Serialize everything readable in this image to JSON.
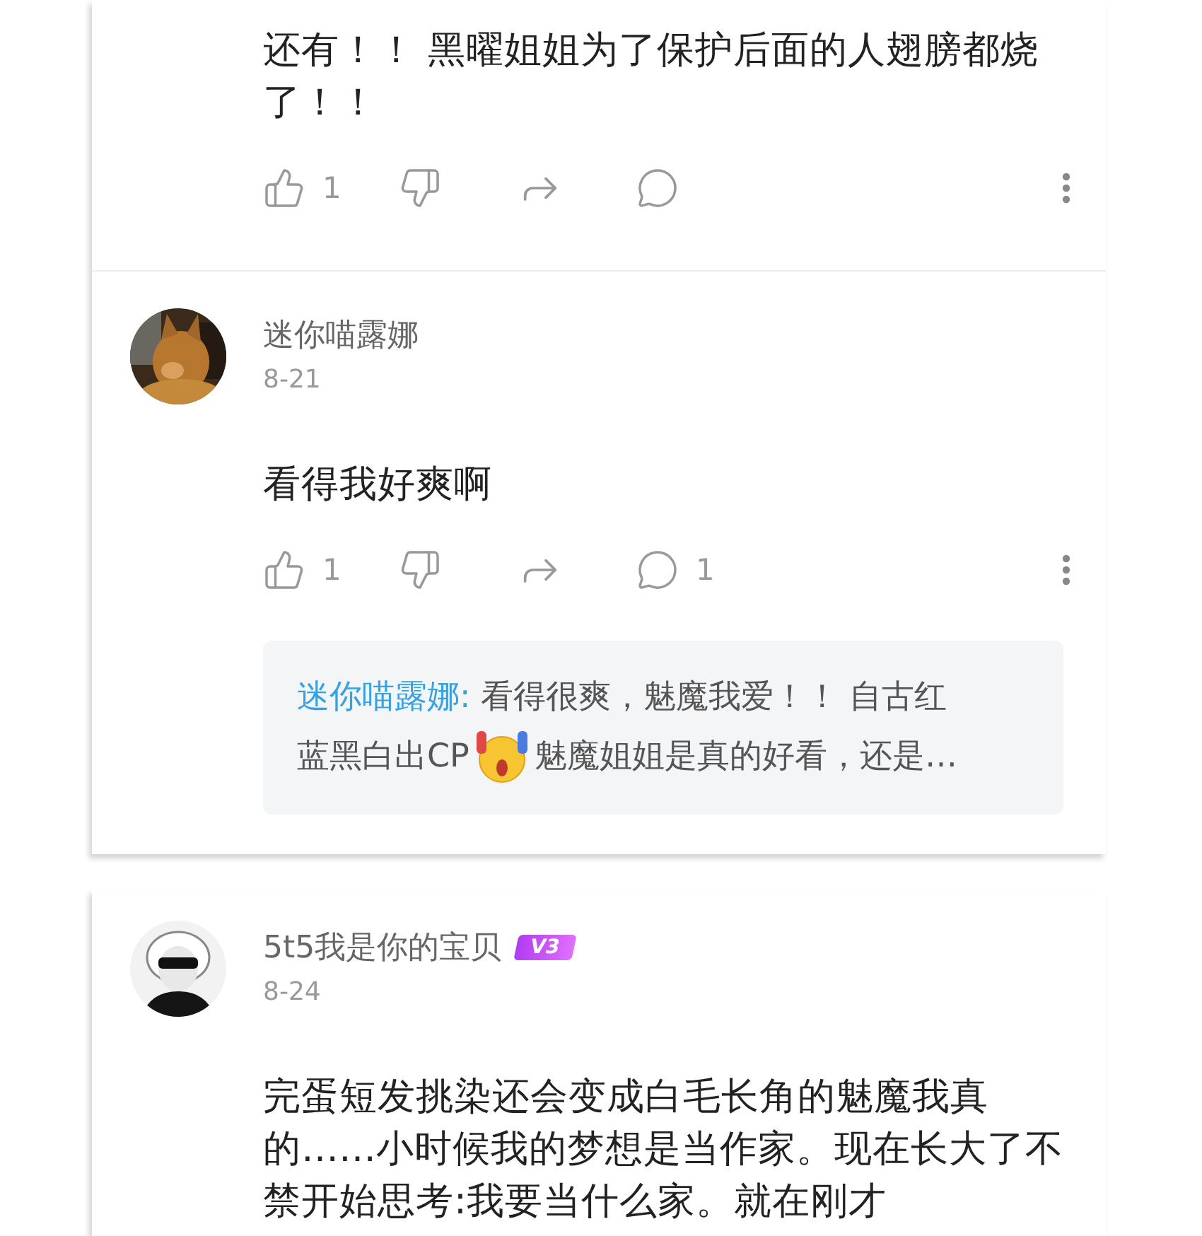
{
  "cards": [
    {
      "comments": [
        {
          "kind": "tail",
          "text": "还有！！ 黑曜姐姐为了保护后面的人翅膀都烧了！！",
          "likes": "1"
        },
        {
          "kind": "full",
          "author": "迷你喵露娜",
          "date": "8-21",
          "text": "看得我好爽啊",
          "likes": "1",
          "replies": "1",
          "reply": {
            "author": "迷你喵露娜:",
            "text_line_1": " 看得很爽，魅魔我爱！！ 自古红",
            "text_before": "蓝黑白出CP",
            "text_after": "魅魔姐姐是真的好看，还是…"
          }
        }
      ]
    },
    {
      "comments": [
        {
          "kind": "full",
          "author": "5t5我是你的宝贝",
          "badge": "V3",
          "date": "8-24",
          "text": "完蛋短发挑染还会变成白毛长角的魅魔我真的……小时候我的梦想是当作家。现在长大了不禁开始思考:我要当什么家。就在刚才"
        }
      ]
    }
  ]
}
